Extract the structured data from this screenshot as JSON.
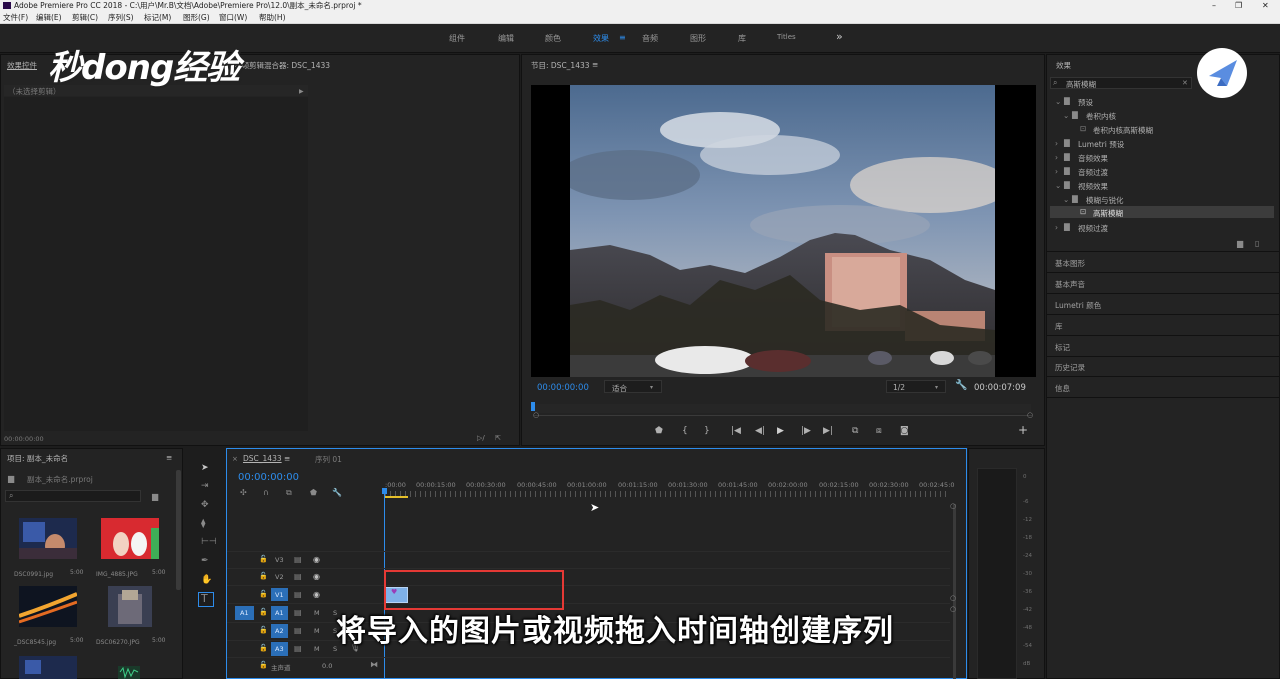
{
  "window": {
    "title": "Adobe Premiere Pro CC 2018 - C:\\用户\\Mr.B\\文档\\Adobe\\Premiere Pro\\12.0\\副本_未命名.prproj *",
    "controls": [
      "–",
      "❐",
      "✕"
    ]
  },
  "menu": [
    "文件(F)",
    "编辑(E)",
    "剪辑(C)",
    "序列(S)",
    "标记(M)",
    "图形(G)",
    "窗口(W)",
    "帮助(H)"
  ],
  "workspaces": {
    "items": [
      "组件",
      "编辑",
      "颜色",
      "效果",
      "音频",
      "图形",
      "库",
      "Titles"
    ],
    "active": "效果",
    "menu_icon": "≡",
    "more": "»"
  },
  "watermark": "秒dong经验",
  "effect_controls": {
    "tab": "效果控件",
    "tab2": "音频剪辑混合器: DSC_1433",
    "no_clip": "（未选择剪辑）",
    "timecode": "00:00:00:00"
  },
  "program_monitor": {
    "tab": "节目: DSC_1433",
    "timecode_left": "00:00:00:00",
    "fit": "适合",
    "resolution": "1/2",
    "timecode_right": "00:00:07:09"
  },
  "effects": {
    "tab": "效果",
    "search_value": "高斯模糊",
    "tree": [
      {
        "label": "预设",
        "level": 0,
        "type": "folder"
      },
      {
        "label": "卷积内核",
        "level": 1,
        "type": "folder"
      },
      {
        "label": "卷积内核高斯模糊",
        "level": 2,
        "type": "preset"
      },
      {
        "label": "Lumetri 预设",
        "level": 0,
        "type": "folder"
      },
      {
        "label": "音频效果",
        "level": 0,
        "type": "folder"
      },
      {
        "label": "音频过渡",
        "level": 0,
        "type": "folder"
      },
      {
        "label": "视频效果",
        "level": 0,
        "type": "folder"
      },
      {
        "label": "模糊与锐化",
        "level": 1,
        "type": "folder"
      },
      {
        "label": "高斯模糊",
        "level": 2,
        "type": "effect",
        "selected": true
      },
      {
        "label": "视频过渡",
        "level": 0,
        "type": "folder"
      }
    ],
    "sections": [
      "基本图形",
      "基本声音",
      "Lumetri 颜色",
      "库",
      "标记",
      "历史记录",
      "信息"
    ]
  },
  "project": {
    "tab": "项目: 副本_未命名",
    "file": "副本_未命名.prproj",
    "items": [
      {
        "name": "DSC0991.jpg",
        "duration": "5:00"
      },
      {
        "name": "IMG_4885.JPG",
        "duration": "5:00"
      },
      {
        "name": "_DSC8545.jpg",
        "duration": "5:00"
      },
      {
        "name": "DSC06270.JPG",
        "duration": "5:00"
      }
    ]
  },
  "timeline": {
    "tab_active": "DSC_1433",
    "tab_other": "序列 01",
    "timecode": "00:00:00:00",
    "ruler": [
      ":00:00",
      "00:00:15:00",
      "00:00:30:00",
      "00:00:45:00",
      "00:01:00:00",
      "00:01:15:00",
      "00:01:30:00",
      "00:01:45:00",
      "00:02:00:00",
      "00:02:15:00",
      "00:02:30:00",
      "00:02:45:0"
    ],
    "video_tracks": [
      "V3",
      "V2",
      "V1"
    ],
    "audio_tracks": [
      "A1",
      "A2",
      "A3"
    ],
    "source_patch_v": "V1",
    "source_patch_a": "A1",
    "mute": "M",
    "solo": "S",
    "master_label": "主声道",
    "master_value": "0.0"
  },
  "meters": {
    "db_ticks": [
      "0",
      "-6",
      "-12",
      "-18",
      "-24",
      "-30",
      "-36",
      "-42",
      "-48",
      "-54",
      "dB"
    ]
  },
  "subtitle": "将导入的图片或视频拖入时间轴创建序列",
  "colors": {
    "accent": "#2d8ceb",
    "panel": "#232323",
    "highlight_box": "#e53935"
  }
}
